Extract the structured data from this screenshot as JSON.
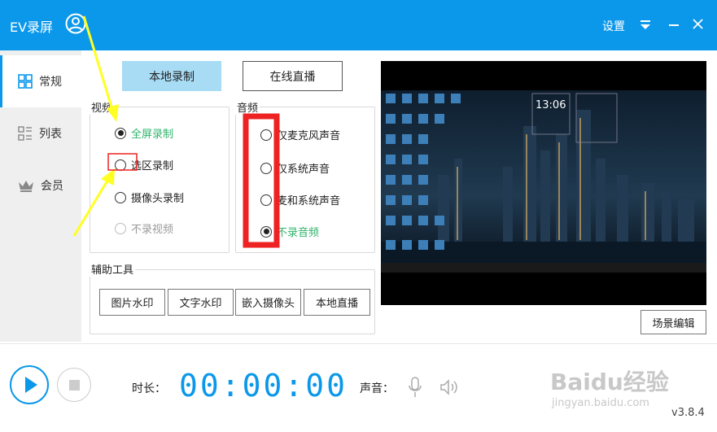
{
  "titlebar": {
    "app_title": "EV录屏",
    "settings_label": "设置"
  },
  "sidebar": {
    "items": [
      {
        "label": "常规",
        "icon": "grid-icon"
      },
      {
        "label": "列表",
        "icon": "list-icon"
      },
      {
        "label": "会员",
        "icon": "crown-icon"
      }
    ]
  },
  "tabs": {
    "local": "本地录制",
    "live": "在线直播"
  },
  "video": {
    "label": "视频",
    "options": [
      {
        "label": "全屏录制",
        "checked": true
      },
      {
        "label": "选区录制",
        "checked": false
      },
      {
        "label": "摄像头录制",
        "checked": false
      },
      {
        "label": "不录视频",
        "checked": false
      }
    ]
  },
  "audio": {
    "label": "音频",
    "options": [
      {
        "label": "仅麦克风声音",
        "checked": false
      },
      {
        "label": "仅系统声音",
        "checked": false
      },
      {
        "label": "麦和系统声音",
        "checked": false
      },
      {
        "label": "不录音频",
        "checked": true
      }
    ]
  },
  "tools": {
    "label": "辅助工具",
    "buttons": [
      "图片水印",
      "文字水印",
      "嵌入摄像头",
      "本地直播"
    ]
  },
  "preview": {
    "clock": "13:06"
  },
  "scene_edit": "场景编辑",
  "bottom": {
    "duration_label": "时长：",
    "timer": "00:00:00",
    "sound_label": "声音：",
    "version": "v3.8.4"
  },
  "watermark": {
    "logo": "Baidu经验",
    "url": "jingyan.baidu.com"
  },
  "colors": {
    "accent": "#0b98ea",
    "selected_text": "#2fb36b",
    "annotation_red": "#ee2222",
    "annotation_yellow": "#ffff22"
  }
}
